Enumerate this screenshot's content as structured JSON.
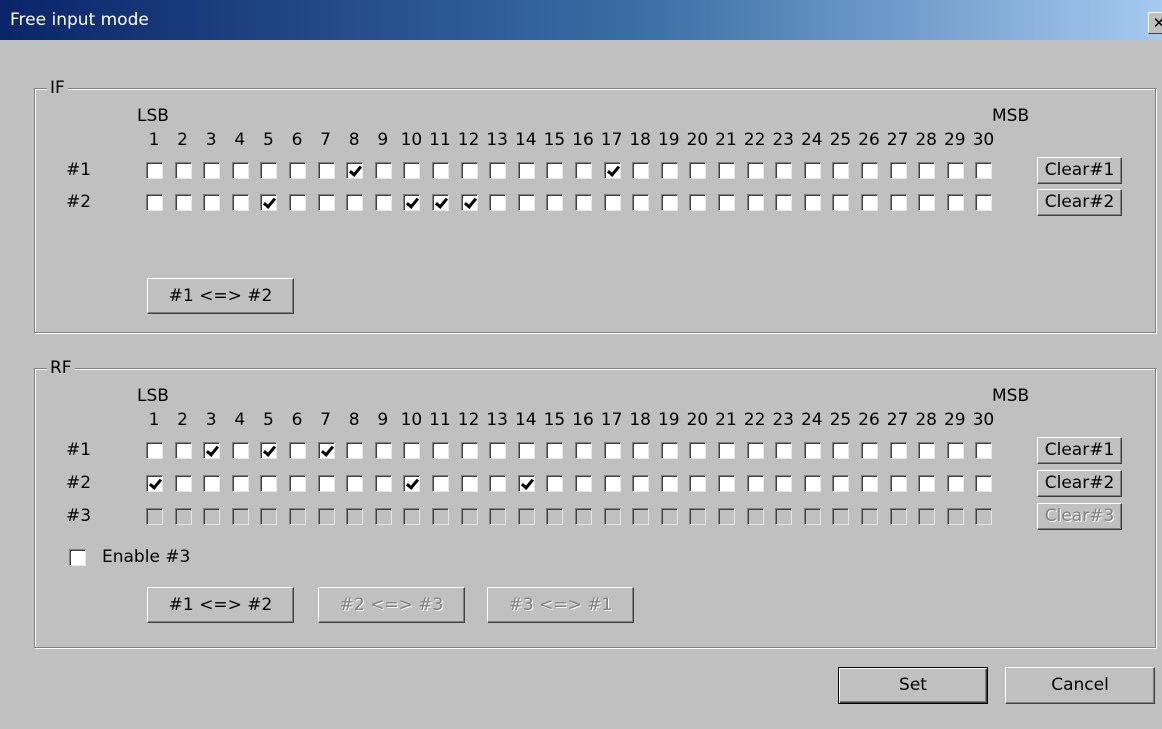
{
  "window": {
    "title": "Free input mode",
    "close_glyph": "✕"
  },
  "if_group": {
    "label": "IF",
    "lsb_label": "LSB",
    "msb_label": "MSB",
    "columns": [
      "1",
      "2",
      "3",
      "4",
      "5",
      "6",
      "7",
      "8",
      "9",
      "10",
      "11",
      "12",
      "13",
      "14",
      "15",
      "16",
      "17",
      "18",
      "19",
      "20",
      "21",
      "22",
      "23",
      "24",
      "25",
      "26",
      "27",
      "28",
      "29",
      "30"
    ],
    "rows": [
      {
        "label": "#1",
        "clear_label": "Clear#1",
        "checked": [
          8,
          17
        ],
        "enabled": true
      },
      {
        "label": "#2",
        "clear_label": "Clear#2",
        "checked": [
          5,
          10,
          11,
          12
        ],
        "enabled": true
      }
    ],
    "swap_buttons": [
      {
        "label": "#1 <=> #2",
        "enabled": true
      }
    ]
  },
  "rf_group": {
    "label": "RF",
    "lsb_label": "LSB",
    "msb_label": "MSB",
    "columns": [
      "1",
      "2",
      "3",
      "4",
      "5",
      "6",
      "7",
      "8",
      "9",
      "10",
      "11",
      "12",
      "13",
      "14",
      "15",
      "16",
      "17",
      "18",
      "19",
      "20",
      "21",
      "22",
      "23",
      "24",
      "25",
      "26",
      "27",
      "28",
      "29",
      "30"
    ],
    "rows": [
      {
        "label": "#1",
        "clear_label": "Clear#1",
        "checked": [
          3,
          5,
          7
        ],
        "enabled": true
      },
      {
        "label": "#2",
        "clear_label": "Clear#2",
        "checked": [
          1,
          10,
          14
        ],
        "enabled": true
      },
      {
        "label": "#3",
        "clear_label": "Clear#3",
        "checked": [],
        "enabled": false
      }
    ],
    "enable3": {
      "label": "Enable #3",
      "checked": false
    },
    "swap_buttons": [
      {
        "label": "#1 <=> #2",
        "enabled": true
      },
      {
        "label": "#2 <=> #3",
        "enabled": false
      },
      {
        "label": "#3 <=> #1",
        "enabled": false
      }
    ]
  },
  "footer": {
    "set_label": "Set",
    "cancel_label": "Cancel"
  }
}
